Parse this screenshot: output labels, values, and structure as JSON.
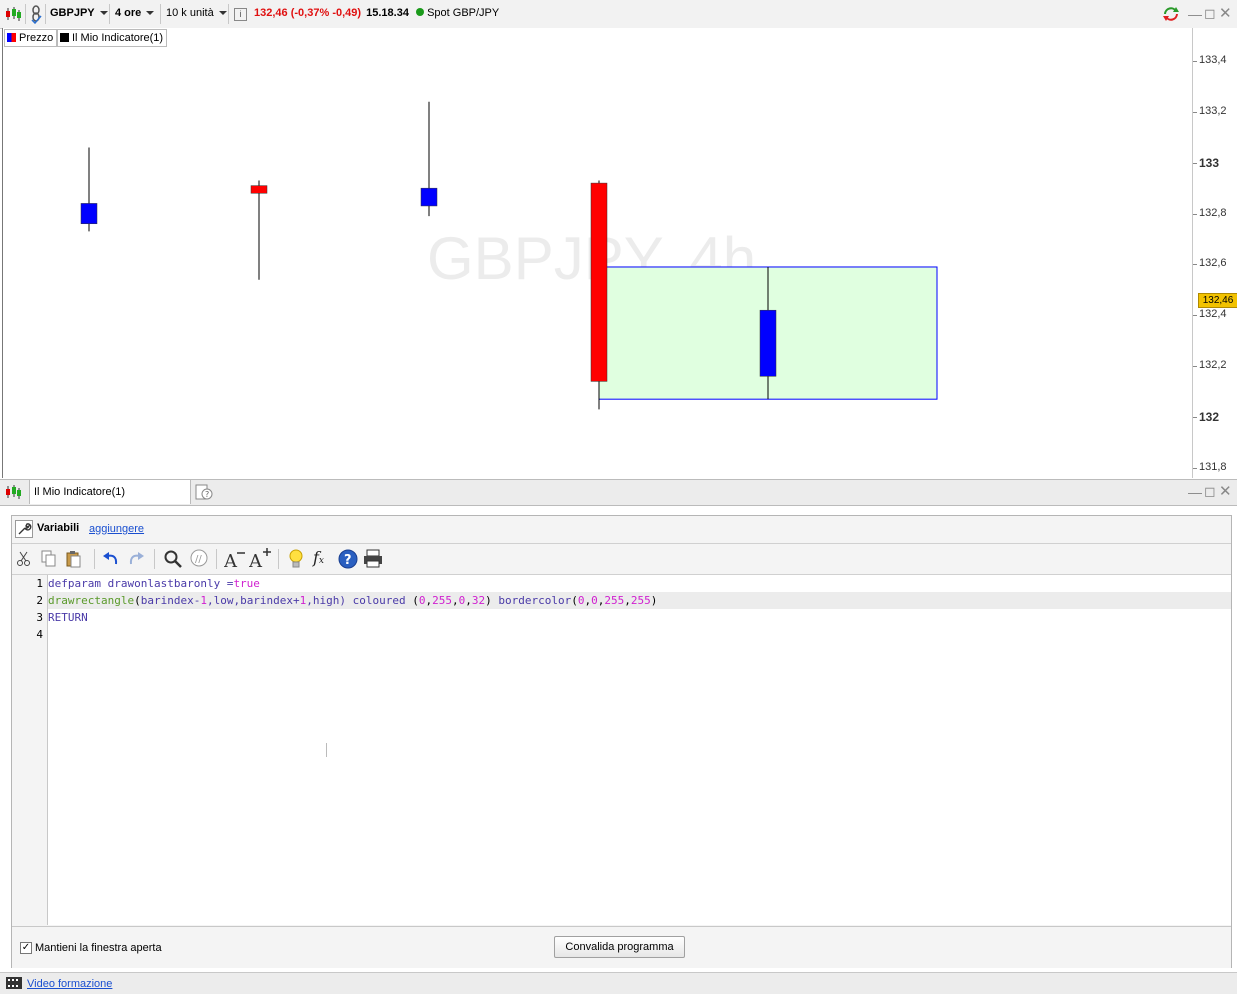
{
  "toolbar": {
    "symbol": "GBPJPY",
    "timeframe": "4 ore",
    "units": "10 k unità",
    "price": "132,46",
    "change": "(-0,37%",
    "change_abs": "-0,49)",
    "time": "15.18.34",
    "instrument": "Spot GBP/JPY"
  },
  "legend": {
    "price": "Prezzo",
    "indicator": "Il Mio Indicatore(1)"
  },
  "chart": {
    "watermark": "GBPJPY, 4h",
    "current_price_tag": "132,46",
    "colors": {
      "bull": "#0000ff",
      "bear": "#ff0000",
      "rect_fill": "#e0ffe0",
      "rect_border": "#0000ff"
    }
  },
  "chart_data": {
    "type": "candlestick",
    "ylim": [
      131.76,
      133.53
    ],
    "y_ticks": [
      "133,4",
      "133,2",
      "133",
      "132,8",
      "132,6",
      "132,4",
      "132,2",
      "132",
      "131,8"
    ],
    "candles": [
      {
        "open": 132.76,
        "close": 132.84,
        "high": 133.06,
        "low": 132.73,
        "color": "bull"
      },
      {
        "open": 132.91,
        "close": 132.88,
        "high": 132.93,
        "low": 132.54,
        "color": "bear"
      },
      {
        "open": 132.83,
        "close": 132.9,
        "high": 133.24,
        "low": 132.79,
        "color": "bull"
      },
      {
        "open": 132.92,
        "close": 132.14,
        "high": 132.93,
        "low": 132.03,
        "color": "bear"
      },
      {
        "open": 132.16,
        "close": 132.42,
        "high": 132.59,
        "low": 132.07,
        "color": "bull"
      }
    ],
    "rectangle": {
      "from_bar": 3,
      "to_bar": 5,
      "low": 132.07,
      "high": 132.59
    }
  },
  "panel": {
    "tab_label": "Il Mio Indicatore(1)"
  },
  "editor": {
    "variables_label": "Variabili",
    "add_link": "aggiungere",
    "line_numbers": [
      "1",
      "2",
      "3",
      "4"
    ],
    "line1": {
      "a": "defparam drawonlastbaronly =",
      "b": "true"
    },
    "line2": {
      "fn": "drawrectangle",
      "p1": "(",
      "args": "barindex-",
      "n1": "1",
      "args2": ",low,barindex+",
      "n2": "1",
      "args3": ",high)",
      "kw1": " coloured ",
      "p2": "(",
      "c1": "0",
      "s1": ",",
      "c2": "255",
      "s2": ",",
      "c3": "0",
      "s3": ",",
      "c4": "32",
      "p3": ") ",
      "kw2": "bordercolor",
      "p4": "(",
      "d1": "0",
      "t1": ",",
      "d2": "0",
      "t2": ",",
      "d3": "255",
      "t3": ",",
      "d4": "255",
      "p5": ")"
    },
    "line3": "RETURN",
    "keep_open_label": "Mantieni la finestra aperta",
    "validate_button": "Convalida programma"
  },
  "footer": {
    "video_link": "Video formazione"
  }
}
